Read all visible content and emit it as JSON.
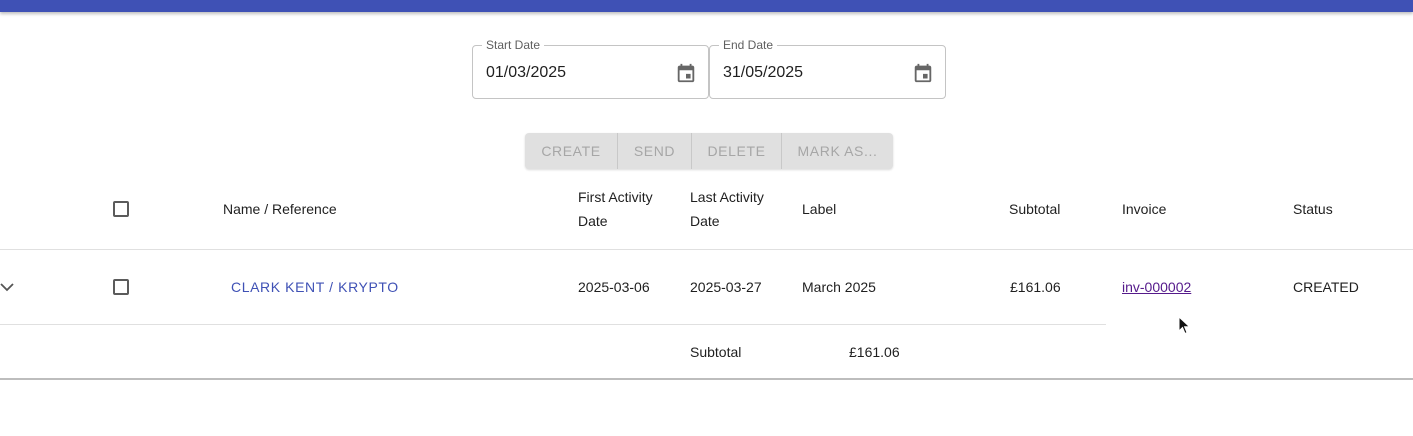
{
  "filters": {
    "start_date": {
      "label": "Start Date",
      "value": "01/03/2025",
      "icon": "calendar-icon"
    },
    "end_date": {
      "label": "End Date",
      "value": "31/05/2025",
      "icon": "calendar-icon"
    }
  },
  "actions": {
    "create": "CREATE",
    "send": "SEND",
    "delete": "DELETE",
    "mark_as": "MARK AS..."
  },
  "table": {
    "headers": {
      "name": "Name / Reference",
      "first_activity_line1": "First Activity",
      "first_activity_line2": "Date",
      "last_activity_line1": "Last Activity",
      "last_activity_line2": "Date",
      "label": "Label",
      "subtotal": "Subtotal",
      "invoice": "Invoice",
      "status": "Status"
    },
    "rows": [
      {
        "name": "CLARK KENT / KRYPTO",
        "first_activity": "2025-03-06",
        "last_activity": "2025-03-27",
        "label": "March 2025",
        "subtotal": "£161.06",
        "invoice": "inv-000002",
        "status": "CREATED"
      }
    ],
    "footer": {
      "label": "Subtotal",
      "value": "£161.06"
    }
  },
  "colors": {
    "app_bar": "#3f51b5",
    "link": "#3f51b5",
    "visited_link": "#551a8b"
  }
}
